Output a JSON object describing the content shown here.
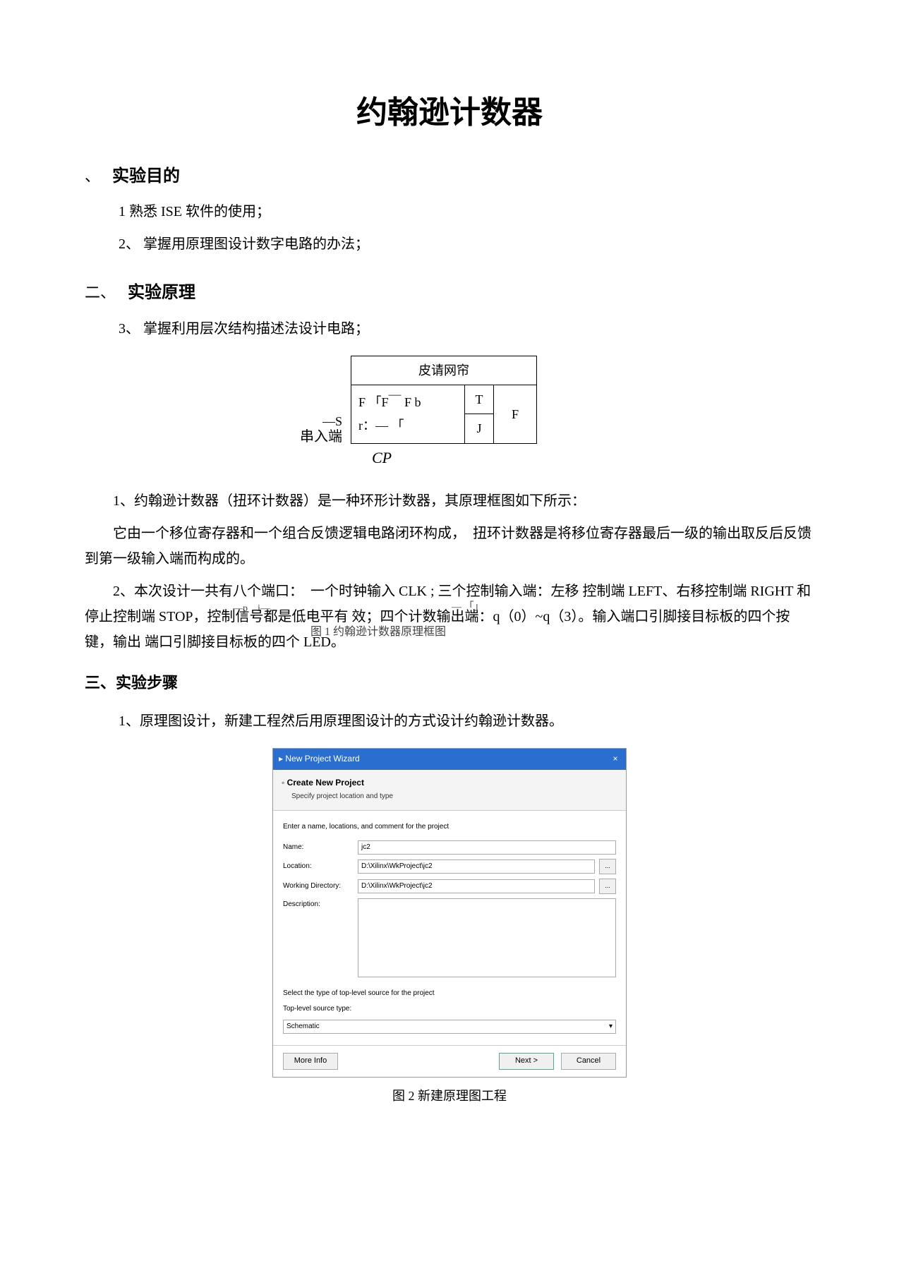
{
  "title": "约翰逊计数器",
  "section1": {
    "number": "、",
    "heading": "实验目的",
    "item1": "1 熟悉 ISE 软件的使用；",
    "item2_num": "2、",
    "item2_text": "掌握用原理图设计数字电路的办法；"
  },
  "section2": {
    "number": "二、",
    "heading": "实验原理",
    "item3_num": "3、",
    "item3_text": "掌握利用层次结构描述法设计电路；"
  },
  "diagram": {
    "header": "皮请网帘",
    "row1c1": "F 「F￣ F b",
    "row2c1": "r：— 「",
    "col2a": "T",
    "col2b": "J",
    "col3": "F",
    "side_s": "—S",
    "side_ru": "串入端",
    "cp": "CP"
  },
  "body": {
    "p1": "1、约翰逊计数器（扭环计数器）是一种环形计数器，其原理框图如下所示：",
    "p2": "它由一个移位寄存器和一个组合反馈逻辑电路闭环构成，　扭环计数器是将移位寄存器最后一级的输出取反后反馈到第一级输入端而构成的。",
    "p3a": "2、本次设计一共有八个端口：　一个时钟输入 CLK ; 三个控制输入端：左移 控制端 LEFT、右移控制端 RIGHT 和停止控制端 STOP，控制信号都是低电平有 效；四个计数输出端：q（0）~q（3）。输入端口引脚接目标板的四个按键，输出 端口引脚接目标板的四个 LED。",
    "ghost1": "—p　i—",
    "ghost2": "— 「」",
    "ghost3": "图 1 约翰逊计数器原理框图"
  },
  "section3": {
    "heading": "三、实验步骤",
    "item1": "1、原理图设计，新建工程然后用原理图设计的方式设计约翰逊计数器。"
  },
  "wizard": {
    "icon": "▸",
    "title": "New Project Wizard",
    "close": "×",
    "create": "Create New Project",
    "sub": "Specify project location and type",
    "instr": "Enter a name, locations, and comment for the project",
    "lbl_name": "Name:",
    "val_name": "jc2",
    "lbl_loc": "Location:",
    "val_loc": "D:\\Xilinx\\WkProject\\jc2",
    "lbl_wd": "Working Directory:",
    "val_wd": "D:\\Xilinx\\WkProject\\jc2",
    "lbl_desc": "Description:",
    "browse": "...",
    "select_text": "Select the type of top-level source for the project",
    "lbl_top": "Top-level source type:",
    "val_top": "Schematic",
    "chev": "▾",
    "more": "More Info",
    "next": "Next >",
    "cancel": "Cancel"
  },
  "fig2_caption": "图 2 新建原理图工程"
}
